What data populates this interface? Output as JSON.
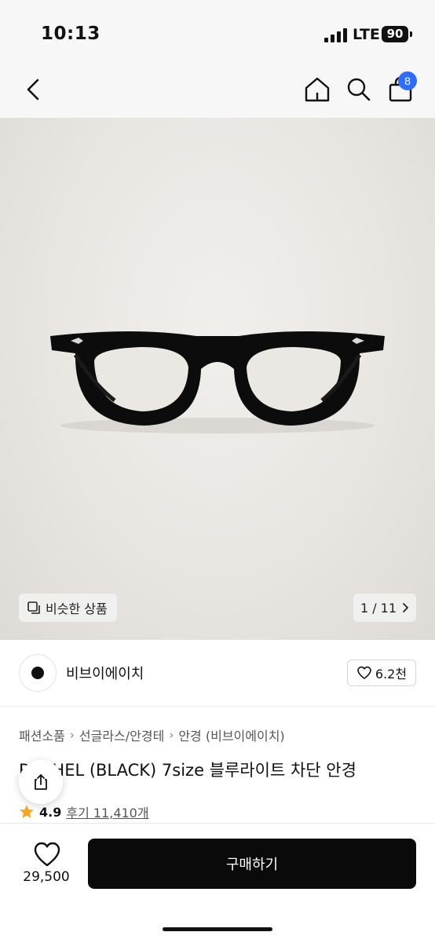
{
  "status": {
    "time": "10:13",
    "network": "LTE",
    "battery": "90"
  },
  "nav": {
    "cart_count": "8"
  },
  "gallery": {
    "similar_label": "비슷한 상품",
    "page_indicator": "1 / 11"
  },
  "brand": {
    "name": "비브이에이치",
    "likes": "6.2천"
  },
  "breadcrumb": [
    "패션소품",
    "선글라스/안경테",
    "안경 (비브이에이치)"
  ],
  "product": {
    "title": "RACHEL (BLACK) 7size 블루라이트 차단 안경",
    "rating": "4.9",
    "reviews": "후기 11,410개"
  },
  "footer": {
    "price": "29,500",
    "buy_label": "구매하기"
  },
  "colors": {
    "accent_badge": "#2f6df6",
    "buy_button": "#0a0a0a",
    "star": "#f5a623"
  },
  "icons": [
    "back-icon",
    "home-icon",
    "search-icon",
    "shopping-bag-icon",
    "similar-icon",
    "chevron-right-icon",
    "heart-icon",
    "share-icon",
    "star-icon"
  ]
}
